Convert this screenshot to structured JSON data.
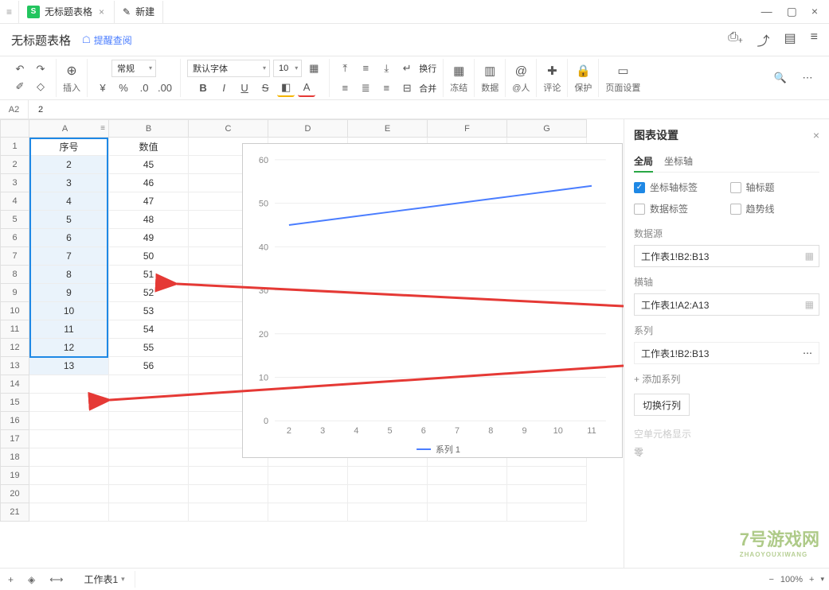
{
  "tabs": {
    "active": "无标题表格",
    "new": "新建"
  },
  "doc": {
    "title": "无标题表格",
    "remind": "提醒查阅"
  },
  "toolbar": {
    "insert": "插入",
    "format_preset": "常规",
    "font": "默认字体",
    "size": "10",
    "wrap": "换行",
    "merge": "合并",
    "freeze": "冻结",
    "data": "数据",
    "mention": "@人",
    "comment": "评论",
    "protect": "保护",
    "page": "页面设置"
  },
  "namebox": "A2",
  "formula": "2",
  "columns": [
    "A",
    "B",
    "C",
    "D",
    "E",
    "F",
    "G"
  ],
  "headers": {
    "a": "序号",
    "b": "数值"
  },
  "rows": [
    {
      "n": 1,
      "a": "序号",
      "b": "数值"
    },
    {
      "n": 2,
      "a": "2",
      "b": "45"
    },
    {
      "n": 3,
      "a": "3",
      "b": "46"
    },
    {
      "n": 4,
      "a": "4",
      "b": "47"
    },
    {
      "n": 5,
      "a": "5",
      "b": "48"
    },
    {
      "n": 6,
      "a": "6",
      "b": "49"
    },
    {
      "n": 7,
      "a": "7",
      "b": "50"
    },
    {
      "n": 8,
      "a": "8",
      "b": "51"
    },
    {
      "n": 9,
      "a": "9",
      "b": "52"
    },
    {
      "n": 10,
      "a": "10",
      "b": "53"
    },
    {
      "n": 11,
      "a": "11",
      "b": "54"
    },
    {
      "n": 12,
      "a": "12",
      "b": "55"
    },
    {
      "n": 13,
      "a": "13",
      "b": "56"
    },
    {
      "n": 14,
      "a": "",
      "b": ""
    },
    {
      "n": 15,
      "a": "",
      "b": ""
    },
    {
      "n": 16,
      "a": "",
      "b": ""
    },
    {
      "n": 17,
      "a": "",
      "b": ""
    },
    {
      "n": 18,
      "a": "",
      "b": ""
    },
    {
      "n": 19,
      "a": "",
      "b": ""
    },
    {
      "n": 20,
      "a": "",
      "b": ""
    },
    {
      "n": 21,
      "a": "",
      "b": ""
    }
  ],
  "chart_data": {
    "type": "line",
    "categories": [
      2,
      3,
      4,
      5,
      6,
      7,
      8,
      9,
      10,
      11
    ],
    "series": [
      {
        "name": "系列 1",
        "values": [
          45,
          46,
          47,
          48,
          49,
          50,
          51,
          52,
          53,
          54
        ]
      }
    ],
    "ylim": [
      0,
      60
    ],
    "yticks": [
      0,
      10,
      20,
      30,
      40,
      50,
      60
    ],
    "xticks": [
      2,
      3,
      4,
      5,
      6,
      7,
      8,
      9,
      10,
      11
    ],
    "legend": "系列 1"
  },
  "panel": {
    "title": "图表设置",
    "tabs": {
      "global": "全局",
      "axes": "坐标轴"
    },
    "checks": {
      "axis_label": "坐标轴标签",
      "axis_title": "轴标题",
      "data_label": "数据标签",
      "trend": "趋势线"
    },
    "checks_on": {
      "axis_label": true,
      "axis_title": false,
      "data_label": false,
      "trend": false
    },
    "datasource": "数据源",
    "datasource_val": "工作表1!B2:B13",
    "xaxis": "横轴",
    "xaxis_val": "工作表1!A2:A13",
    "series": "系列",
    "series_val": "工作表1!B2:B13",
    "add_series": "+ 添加系列",
    "switch": "切换行列",
    "blank_cell": "空单元格显示",
    "zero": "零"
  },
  "footer": {
    "sheet": "工作表1",
    "zoom": "100%"
  },
  "watermark": {
    "brand": "7号游戏网",
    "sub": "ZHAOYOUXIWANG"
  }
}
